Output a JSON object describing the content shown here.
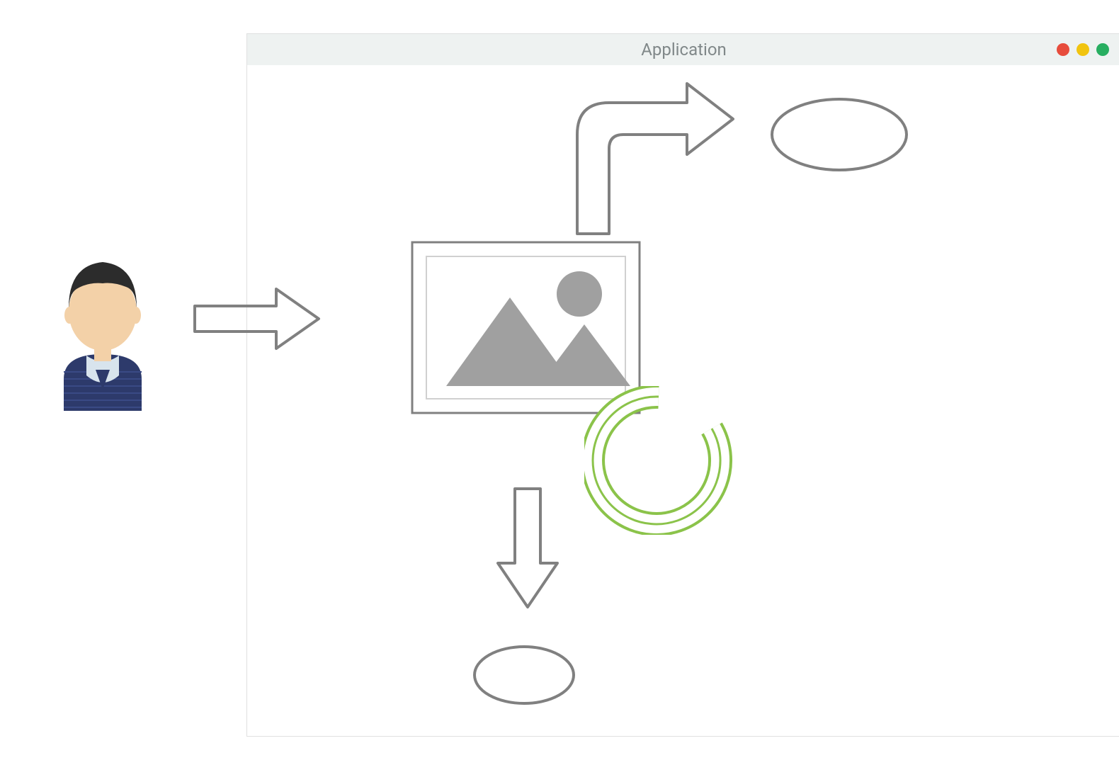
{
  "window": {
    "title": "Application",
    "traffic_lights": [
      "red",
      "yellow",
      "green"
    ]
  },
  "diagram": {
    "actors": {
      "user": "user-person"
    },
    "nodes": {
      "central": "image-placeholder",
      "output_top": "ellipse",
      "output_bottom": "ellipse"
    },
    "flows": {
      "input": "arrow-right",
      "branch_up": "arrow-up-right",
      "branch_down": "arrow-down",
      "processing": "spinner"
    },
    "colors": {
      "stroke": "#808080",
      "fill_gray": "#a0a0a0",
      "spinner": "#8bc34a",
      "skin": "#f3d1a8",
      "hair": "#2c2c2c",
      "shirt": "#2d3a6b",
      "collar": "#d8e4ed"
    }
  }
}
